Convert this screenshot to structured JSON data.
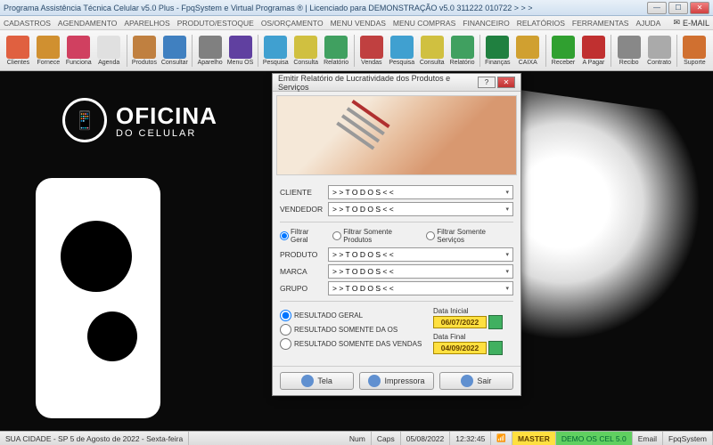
{
  "titlebar": {
    "text": "Programa Assistência Técnica Celular v5.0 Plus - FpqSystem e Virtual Programas ® | Licenciado para  DEMONSTRAÇÃO v5.0 311222 010722 > > >"
  },
  "menubar": {
    "items": [
      "CADASTROS",
      "AGENDAMENTO",
      "APARELHOS",
      "PRODUTO/ESTOQUE",
      "OS/ORÇAMENTO",
      "MENU VENDAS",
      "MENU COMPRAS",
      "FINANCEIRO",
      "RELATÓRIOS",
      "FERRAMENTAS",
      "AJUDA"
    ],
    "email": "E-MAIL"
  },
  "toolbar": {
    "items": [
      {
        "label": "Clientes",
        "color": "#e06040"
      },
      {
        "label": "Fornece",
        "color": "#d09030"
      },
      {
        "label": "Funciona",
        "color": "#d04060"
      },
      {
        "label": "Agenda",
        "color": "#e0e0e0"
      },
      {
        "label": "Produtos",
        "color": "#c08040"
      },
      {
        "label": "Consultar",
        "color": "#4080c0"
      },
      {
        "label": "Aparelho",
        "color": "#808080"
      },
      {
        "label": "Menu OS",
        "color": "#6040a0"
      },
      {
        "label": "Pesquisa",
        "color": "#40a0d0"
      },
      {
        "label": "Consulta",
        "color": "#d0c040"
      },
      {
        "label": "Relatório",
        "color": "#40a060"
      },
      {
        "label": "Vendas",
        "color": "#c04040"
      },
      {
        "label": "Pesquisa",
        "color": "#40a0d0"
      },
      {
        "label": "Consulta",
        "color": "#d0c040"
      },
      {
        "label": "Relatório",
        "color": "#40a060"
      },
      {
        "label": "Finanças",
        "color": "#208040"
      },
      {
        "label": "CAIXA",
        "color": "#d0a030"
      },
      {
        "label": "Receber",
        "color": "#30a030"
      },
      {
        "label": "A Pagar",
        "color": "#c03030"
      },
      {
        "label": "Recibo",
        "color": "#888"
      },
      {
        "label": "Contrato",
        "color": "#aaa"
      },
      {
        "label": "Suporte",
        "color": "#d07030"
      }
    ]
  },
  "logo": {
    "line1": "OFICINA",
    "line2": "DO CELULAR"
  },
  "dialog": {
    "title": "Emitir Relatório de Lucratividade dos Produtos e Serviços",
    "fields": {
      "cliente_label": "CLIENTE",
      "cliente_value": "> > T O D O S < <",
      "vendedor_label": "VENDEDOR",
      "vendedor_value": "> > T O D O S < <",
      "produto_label": "PRODUTO",
      "produto_value": "> > T O D O S < <",
      "marca_label": "MARCA",
      "marca_value": "> > T O D O S < <",
      "grupo_label": "GRUPO",
      "grupo_value": "> > T O D O S < <"
    },
    "filter_radios": {
      "geral": "Filtrar Geral",
      "produtos": "Filtrar Somente Produtos",
      "servicos": "Filtrar Somente Serviços"
    },
    "result_radios": {
      "geral": "RESULTADO GERAL",
      "os": "RESULTADO SOMENTE DA OS",
      "vendas": "RESULTADO SOMENTE DAS VENDAS"
    },
    "dates": {
      "inicial_label": "Data Inicial",
      "inicial_value": "06/07/2022",
      "final_label": "Data Final",
      "final_value": "04/09/2022"
    },
    "buttons": {
      "tela": "Tela",
      "impressora": "Impressora",
      "sair": "Sair"
    }
  },
  "statusbar": {
    "location": "SUA CIDADE - SP  5 de Agosto de 2022 - Sexta-feira",
    "num": "Num",
    "caps": "Caps",
    "date": "05/08/2022",
    "time": "12:32:45",
    "master": "MASTER",
    "demo": "DEMO OS CEL 5.0",
    "email": "Email",
    "brand": "FpqSystem"
  }
}
